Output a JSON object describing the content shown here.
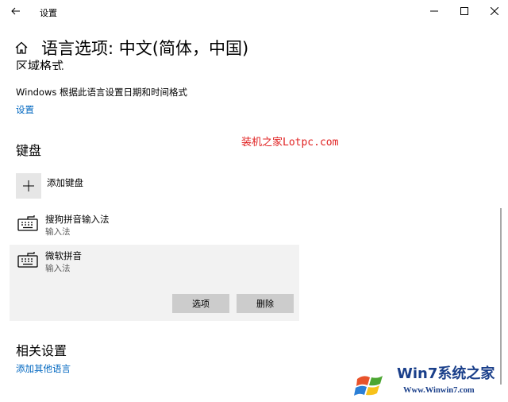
{
  "window": {
    "title": "设置",
    "back": "back-arrow-icon",
    "controls": [
      "minimize-icon",
      "maximize-icon",
      "close-icon"
    ]
  },
  "header": {
    "title": "语言选项: 中文(简体，中国)",
    "icon": "home-icon"
  },
  "region": {
    "heading": "区域格式",
    "description": "Windows 根据此语言设置日期和时间格式",
    "settings_link": "设置"
  },
  "watermark": "装机之家Lotpc.com",
  "keyboard": {
    "heading": "键盘",
    "add_label": "添加键盘",
    "items": [
      {
        "name": "搜狗拼音输入法",
        "type": "输入法",
        "icon": "keyboard-icon"
      },
      {
        "name": "微软拼音",
        "type": "输入法",
        "icon": "keyboard-icon"
      }
    ],
    "options_label": "选项",
    "delete_label": "删除"
  },
  "related": {
    "heading": "相关设置",
    "add_other_lang": "添加其他语言"
  },
  "logo": {
    "text": "Win7系统之家",
    "url": "Www.Winwin7.com"
  },
  "colors": {
    "link": "#0067c0",
    "watermark": "#e02020",
    "selected_bg": "#f2f2f2",
    "button_bg": "#cccccc"
  }
}
